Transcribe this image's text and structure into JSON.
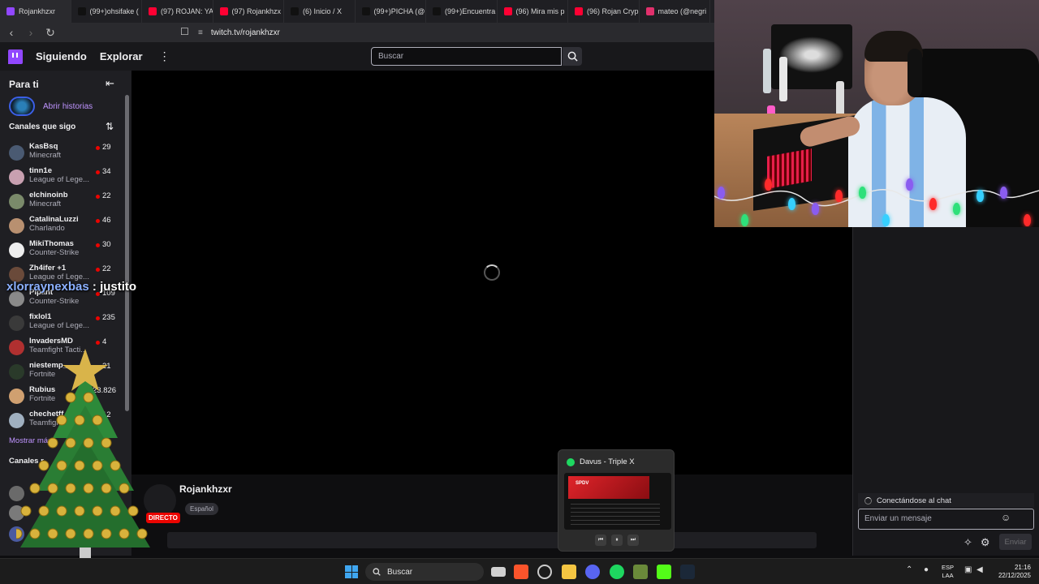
{
  "browser": {
    "tabs": [
      {
        "title": "Rojankhzxr",
        "icon": "twitch-icon",
        "color": "#9147ff"
      },
      {
        "title": "(99+)ohsifake (",
        "icon": "tiktok-icon",
        "color": "#111111"
      },
      {
        "title": "(97) ROJAN: YA",
        "icon": "youtube-icon",
        "color": "#ff0033"
      },
      {
        "title": "(97) Rojankhzx",
        "icon": "youtube-icon",
        "color": "#ff0033"
      },
      {
        "title": "(6) Inicio / X",
        "icon": "x-icon",
        "color": "#111111"
      },
      {
        "title": "(99+)PICHA (@",
        "icon": "tiktok-icon",
        "color": "#111111"
      },
      {
        "title": "(99+)Encuentra",
        "icon": "tiktok-icon",
        "color": "#111111"
      },
      {
        "title": "(96) Mira mis p",
        "icon": "youtube-icon",
        "color": "#ff0033"
      },
      {
        "title": "(96) Rojan Cryp",
        "icon": "youtube-icon",
        "color": "#ff0033"
      },
      {
        "title": "mateo (@negri",
        "icon": "instagram-icon",
        "color": "#e1306c"
      }
    ],
    "url": "twitch.tv/rojankhzxr"
  },
  "twitch": {
    "nav": {
      "following": "Siguiendo",
      "browse": "Explorar",
      "search_placeholder": "Buscar"
    },
    "sidebar": {
      "for_you": "Para ti",
      "open_stories": "Abrir historias",
      "followed_heading": "Canales que sigo",
      "channels": [
        {
          "name": "KasBsq",
          "game": "Minecraft",
          "viewers": "29",
          "avatar": "#4a5a72"
        },
        {
          "name": "tinn1e",
          "game": "League of Lege...",
          "viewers": "34",
          "avatar": "#c8a0b0"
        },
        {
          "name": "elchinoinb",
          "game": "Minecraft",
          "viewers": "22",
          "avatar": "#7a8a6a"
        },
        {
          "name": "CatalinaLuzzi",
          "game": "Charlando",
          "viewers": "46",
          "avatar": "#b89070"
        },
        {
          "name": "MikiThomas",
          "game": "Counter-Strike",
          "viewers": "30",
          "avatar": "#eeeeee"
        },
        {
          "name": "Zh4ifer +1",
          "game": "League of Lege...",
          "viewers": "22",
          "avatar": "#6a4a3a"
        },
        {
          "name": "Pipant",
          "game": "Counter-Strike",
          "viewers": "109",
          "avatar": "#8a8a8a"
        },
        {
          "name": "fixlol1",
          "game": "League of Lege...",
          "viewers": "235",
          "avatar": "#3a3a3a"
        },
        {
          "name": "InvadersMD",
          "game": "Teamfight Tacti...",
          "viewers": "4",
          "avatar": "#b03030"
        },
        {
          "name": "niestemp_",
          "game": "Fortnite",
          "viewers": "21",
          "avatar": "#2a3a2a"
        },
        {
          "name": "Rubius",
          "game": "Fortnite",
          "viewers": "23.826",
          "avatar": "#d0a070"
        },
        {
          "name": "chechetff",
          "game": "Teamfight",
          "viewers": "12",
          "avatar": "#a0b0c0"
        }
      ],
      "show_more": "Mostrar más",
      "recommended_heading": "Canales r"
    },
    "stream": {
      "channel_name": "Rojankhzxr",
      "live_badge": "DIRECTO",
      "tag": "Español"
    },
    "chat": {
      "status": "Conectándose al chat",
      "input_placeholder": "Enviar un mensaje",
      "send_label": "Enviar"
    }
  },
  "overlay": {
    "chat_user": "xlorraynexbas",
    "chat_text": ": justito"
  },
  "spotify": {
    "track": "Davus - Triple X",
    "thumb_label": "SPDV"
  },
  "taskbar": {
    "search_placeholder": "Buscar",
    "language": "ESP",
    "region": "LAA",
    "time": "21:16",
    "date": "22/12/2025"
  }
}
